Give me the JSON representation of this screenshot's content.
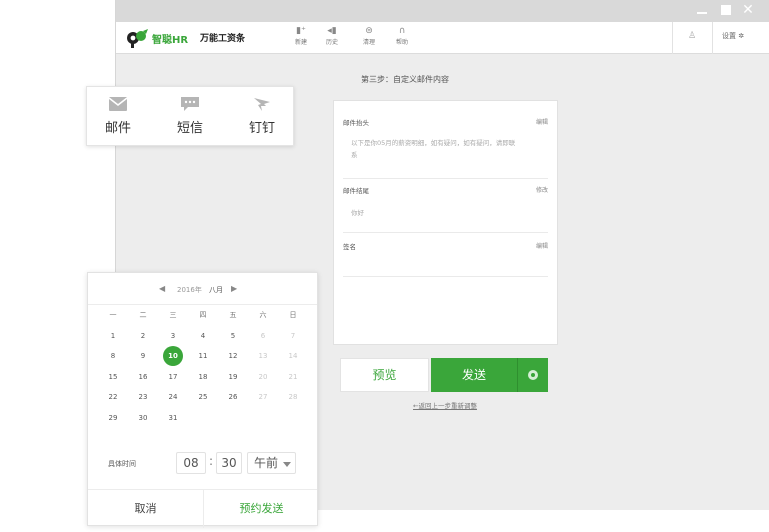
{
  "app": {
    "logo_text": "智聪HR",
    "slogan": "万能工资条",
    "accent_color": "#3aa63a"
  },
  "toolbar": {
    "nav": [
      {
        "label": "新建",
        "icon": "new-icon"
      },
      {
        "label": "历史",
        "icon": "history-icon"
      },
      {
        "label": "清理",
        "icon": "cleanup-icon"
      },
      {
        "label": "帮助",
        "icon": "help-icon"
      }
    ],
    "settings_label": "设置 ✲"
  },
  "main": {
    "step_title": "第三步：自定义邮件内容",
    "card": {
      "header": {
        "label": "邮件抬头",
        "action": "编辑",
        "text": "以下是你05月的薪资明细，如有疑问，如有疑问，请即联系"
      },
      "footer": {
        "label": "邮件结尾",
        "action": "修改",
        "text": "你好"
      },
      "signature": {
        "label": "签名",
        "action": "编辑"
      }
    },
    "preview_label": "预览",
    "send_label": "发送",
    "back_link": "返回上一步重新调整"
  },
  "channels": [
    {
      "label": "邮件",
      "icon": "mail-icon"
    },
    {
      "label": "短信",
      "icon": "sms-icon"
    },
    {
      "label": "钉钉",
      "icon": "dingtalk-icon"
    }
  ],
  "picker": {
    "year": "2016年",
    "month": "八月",
    "weekdays": [
      "一",
      "二",
      "三",
      "四",
      "五",
      "六",
      "日"
    ],
    "weeks": [
      [
        "1",
        "2",
        "3",
        "4",
        "5",
        "6",
        "7"
      ],
      [
        "8",
        "9",
        "10",
        "11",
        "12",
        "13",
        "14"
      ],
      [
        "15",
        "16",
        "17",
        "18",
        "19",
        "20",
        "21"
      ],
      [
        "22",
        "23",
        "24",
        "25",
        "26",
        "27",
        "28"
      ],
      [
        "29",
        "30",
        "31",
        "",
        "",
        "",
        ""
      ]
    ],
    "selected_day": "10",
    "time_label": "具体时间",
    "hour": "08",
    "minute": "30",
    "ampm": "午前",
    "cancel_label": "取消",
    "confirm_label": "预约发送"
  }
}
